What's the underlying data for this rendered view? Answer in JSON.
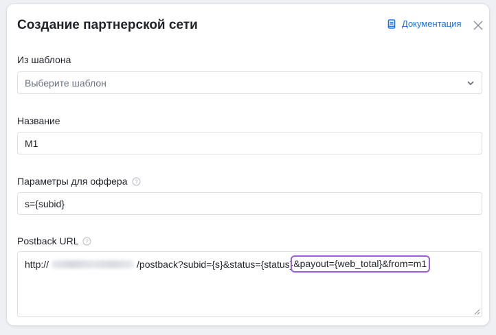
{
  "dialog": {
    "title": "Создание партнерской сети",
    "doc_link": "Документация",
    "doc_icon": "book-icon",
    "close_icon": "close-icon"
  },
  "template": {
    "label": "Из шаблона",
    "placeholder": "Выберите шаблон"
  },
  "name": {
    "label": "Название",
    "value": "M1"
  },
  "offer_params": {
    "label": "Параметры для оффера",
    "value": "s={subid}"
  },
  "postback": {
    "label": "Postback URL",
    "prefix": "http://",
    "middle": "/postback?subid={s}&status={status}",
    "highlighted": "&payout={web_total}&from=m1"
  },
  "colors": {
    "accent": "#1a73e8",
    "highlight": "#9b5de5"
  }
}
